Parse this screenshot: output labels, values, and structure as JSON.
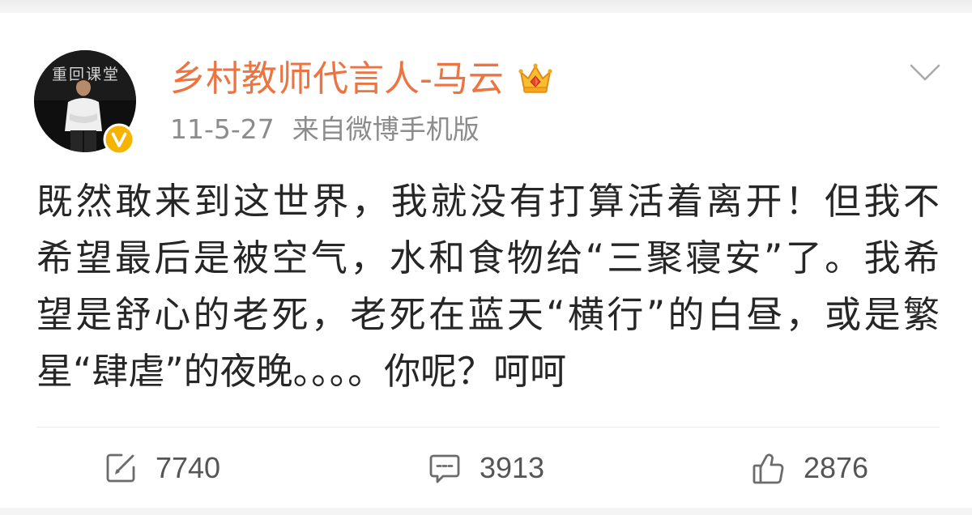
{
  "user": {
    "name": "乡村教师代言人-马云",
    "avatar_caption": "重回课堂",
    "verified_icon": "verified-v-icon",
    "member_icon": "crown-icon"
  },
  "meta": {
    "date": "11-5-27",
    "source": "来自微博手机版"
  },
  "menu_icon": "chevron-down-icon",
  "post": {
    "lines": [
      "既然敢来到这世界，我就没有打算活着离开！但我不",
      "希望最后是被空气，水和食物给“三聚寝安”了。我希",
      "望是舒心的老死，老死在蓝天“横行”的白昼，或是繁",
      "星“肆虐”的夜晚。。。。你呢？呵呵"
    ]
  },
  "actions": [
    {
      "icon": "repost-icon",
      "count": "7740"
    },
    {
      "icon": "comment-icon",
      "count": "3913"
    },
    {
      "icon": "like-icon",
      "count": "2876"
    }
  ],
  "colors": {
    "name": "#ED7340",
    "body_text": "#262626",
    "meta_text": "#8C8C8C",
    "counts": "#555555",
    "verified_badge": "#F6B400",
    "crown": "#F4B400",
    "background": "#FFFFFF"
  }
}
